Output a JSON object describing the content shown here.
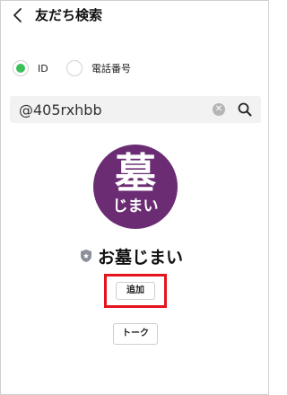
{
  "header": {
    "title": "友だち検索",
    "back_icon": "chevron-left-icon"
  },
  "search_type": {
    "options": [
      {
        "label": "ID",
        "selected": true
      },
      {
        "label": "電話番号",
        "selected": false
      }
    ],
    "selected_color": "#3cc05a"
  },
  "search": {
    "value": "@405rxhbb",
    "clear_icon": "clear-icon",
    "search_icon": "search-icon"
  },
  "profile": {
    "avatar_text_top": "墓",
    "avatar_text_bottom": "じまい",
    "avatar_color": "#6b2c73",
    "badge_icon": "shield-icon",
    "name": "お墓じまい"
  },
  "actions": {
    "add_label": "追加",
    "talk_label": "トーク",
    "highlight_color": "#e3141e"
  }
}
